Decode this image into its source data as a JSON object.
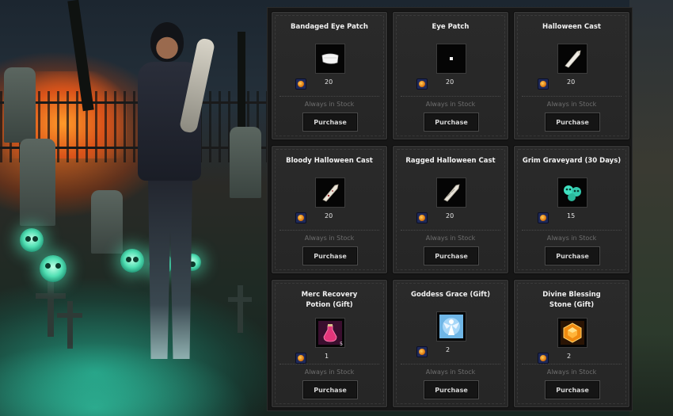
{
  "shop": {
    "items": [
      {
        "title": "Bandaged Eye Patch",
        "price": "20",
        "stock": "Always in Stock",
        "button": "Purchase",
        "icon": "bandaged-eye-patch-icon"
      },
      {
        "title": "Eye Patch",
        "price": "20",
        "stock": "Always in Stock",
        "button": "Purchase",
        "icon": "eye-patch-icon"
      },
      {
        "title": "Halloween Cast",
        "price": "20",
        "stock": "Always in Stock",
        "button": "Purchase",
        "icon": "halloween-cast-icon"
      },
      {
        "title": "Bloody Halloween Cast",
        "price": "20",
        "stock": "Always in Stock",
        "button": "Purchase",
        "icon": "bloody-cast-icon"
      },
      {
        "title": "Ragged Halloween Cast",
        "price": "20",
        "stock": "Always in Stock",
        "button": "Purchase",
        "icon": "ragged-cast-icon"
      },
      {
        "title": "Grim Graveyard (30 Days)",
        "price": "15",
        "stock": "Always in Stock",
        "button": "Purchase",
        "icon": "skulls-icon"
      },
      {
        "title": "Merc Recovery Potion (Gift)",
        "price": "1",
        "stock": "Always in Stock",
        "button": "Purchase",
        "icon": "potion-icon",
        "quantity": "5"
      },
      {
        "title": "Goddess Grace (Gift)",
        "price": "2",
        "stock": "Always in Stock",
        "button": "Purchase",
        "icon": "goddess-icon"
      },
      {
        "title": "Divine Blessing Stone (Gift)",
        "price": "2",
        "stock": "Always in Stock",
        "button": "Purchase",
        "icon": "gem-icon"
      }
    ]
  },
  "colors": {
    "currency": "#e07a10",
    "panel": "#161616",
    "card": "#2a2a2a",
    "title_text": "#f2f2f2",
    "stock_text": "#6e6e6e"
  }
}
